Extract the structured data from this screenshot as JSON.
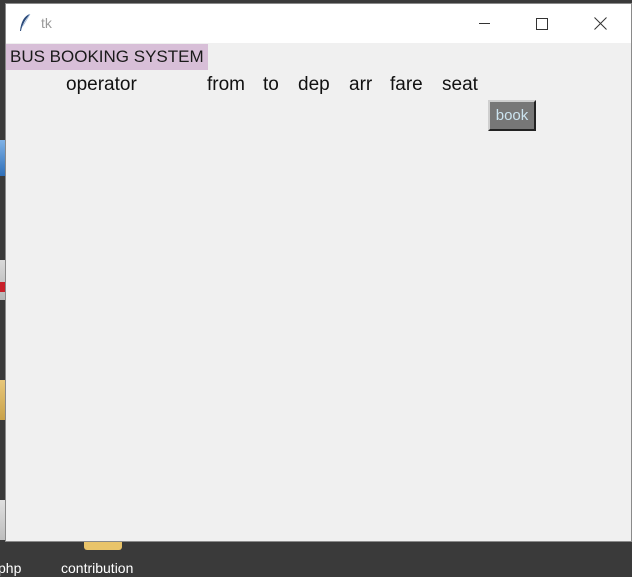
{
  "window": {
    "title": "tk",
    "controls": [
      "minimize",
      "maximize",
      "close"
    ]
  },
  "app": {
    "title": "BUS BOOKING SYSTEM",
    "title_bg": "#d8bfd8",
    "columns": [
      "operator",
      "from",
      "to",
      "dep",
      "arr",
      "fare",
      "seat"
    ],
    "book_label": "book"
  },
  "desktop": {
    "icon_labels": [
      "php",
      "contribution"
    ]
  }
}
